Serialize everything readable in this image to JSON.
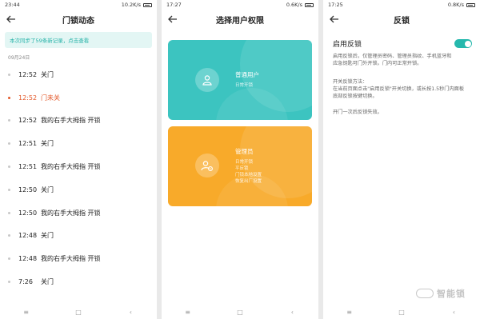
{
  "screen1": {
    "status": {
      "time": "23:44",
      "net": "10.2K/s"
    },
    "title": "门锁动态",
    "sync_banner": "本次同步了59条新记录，点击查看",
    "date": "09月24日",
    "logs": [
      {
        "time": "12:52",
        "event": "关门"
      },
      {
        "time": "12:52",
        "event": "门未关"
      },
      {
        "time": "12:52",
        "event": "我的右手大拇指 开锁"
      },
      {
        "time": "12:51",
        "event": "关门"
      },
      {
        "time": "12:51",
        "event": "我的右手大拇指 开锁"
      },
      {
        "time": "12:50",
        "event": "关门"
      },
      {
        "time": "12:50",
        "event": "我的右手大拇指 开锁"
      },
      {
        "time": "12:48",
        "event": "关门"
      },
      {
        "time": "12:48",
        "event": "我的右手大拇指 开锁"
      },
      {
        "time": "7:26",
        "event": "关门"
      }
    ]
  },
  "screen2": {
    "status": {
      "time": "17:27",
      "net": "0.6K/s"
    },
    "title": "选择用户权限",
    "cards": [
      {
        "title": "普通用户",
        "lines": [
          "日常开锁"
        ]
      },
      {
        "title": "管理员",
        "lines": [
          "日常开锁",
          "平反锁",
          "门锁本地设置",
          "恢复出厂设置"
        ]
      }
    ]
  },
  "screen3": {
    "status": {
      "time": "17:25",
      "net": "0.8K/s"
    },
    "title": "反锁",
    "toggle_label": "启用反锁",
    "toggle_on": true,
    "description": "启用反锁后，仅管理员密码、管理员指纹、手机蓝牙和应急钥匙可门外开锁。门内可正常开锁。",
    "method_title": "开关反锁方法：",
    "method_text": "在当前页面点击\"启用反锁\"开关切换，或长按1.5秒门内面板底部反锁按键切换。",
    "note": "开门一次后反锁失效。",
    "watermark": "智能锁"
  },
  "nav": {
    "menu": "≡",
    "home": "□",
    "back": "‹"
  },
  "colors": {
    "accent_teal": "#26b8ad",
    "alert": "#e3592b",
    "card_teal": "#3cc4c0",
    "card_orange": "#f8aa2a"
  }
}
